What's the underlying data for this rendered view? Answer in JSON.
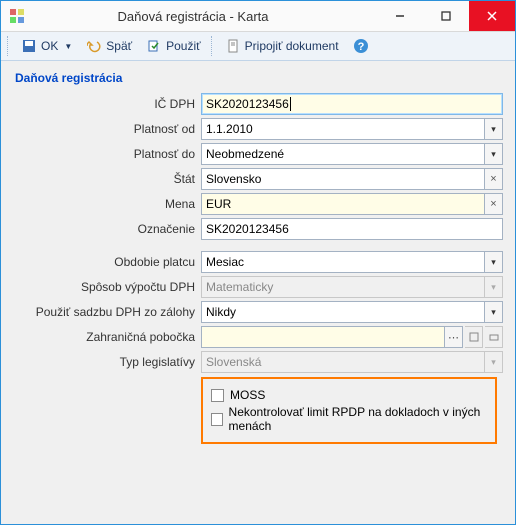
{
  "window": {
    "title": "Daňová registrácia - Karta"
  },
  "toolbar": {
    "ok": "OK",
    "back": "Späť",
    "use": "Použiť",
    "attach": "Pripojiť dokument"
  },
  "section": {
    "title": "Daňová registrácia"
  },
  "labels": {
    "ic_dph": "IČ DPH",
    "platnost_od": "Platnosť od",
    "platnost_do": "Platnosť do",
    "stat": "Štát",
    "mena": "Mena",
    "oznacenie": "Označenie",
    "obdobie": "Obdobie platcu",
    "sposob": "Spôsob výpočtu DPH",
    "pouzit_sadzbu": "Použiť sadzbu DPH zo zálohy",
    "zahran": "Zahraničná pobočka",
    "typ_leg": "Typ legislatívy"
  },
  "values": {
    "ic_dph": "SK2020123456",
    "platnost_od": "1.1.2010",
    "platnost_do": "Neobmedzené",
    "stat": "Slovensko",
    "mena": "EUR",
    "oznacenie": "SK2020123456",
    "obdobie": "Mesiac",
    "sposob": "Matematicky",
    "pouzit_sadzbu": "Nikdy",
    "zahran": "",
    "typ_leg": "Slovenská"
  },
  "checkboxes": {
    "moss": "MOSS",
    "nekontrolovat": "Nekontrolovať limit RPDP na dokladoch v iných menách"
  }
}
